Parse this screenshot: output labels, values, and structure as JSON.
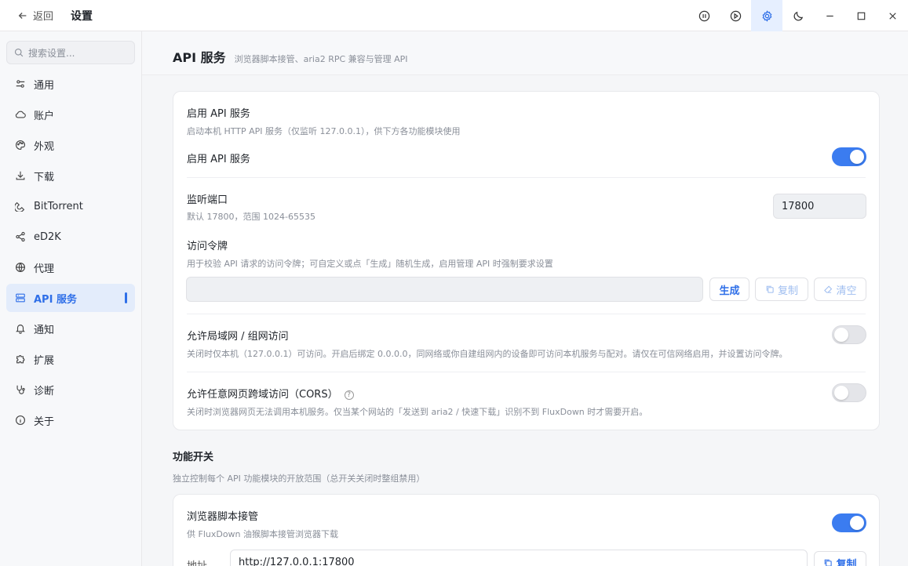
{
  "titlebar": {
    "back_label": "返回",
    "title": "设置",
    "buttons": [
      "pause-all-icon",
      "start-all-icon",
      "settings-icon",
      "theme-icon",
      "minimize-icon",
      "maximize-icon",
      "close-icon"
    ]
  },
  "sidebar": {
    "search_placeholder": "搜索设置...",
    "items": [
      {
        "label": "通用",
        "icon": "sliders-icon"
      },
      {
        "label": "账户",
        "icon": "cloud-icon"
      },
      {
        "label": "外观",
        "icon": "palette-icon"
      },
      {
        "label": "下载",
        "icon": "download-icon"
      },
      {
        "label": "BitTorrent",
        "icon": "magnet-icon"
      },
      {
        "label": "eD2K",
        "icon": "share-icon"
      },
      {
        "label": "代理",
        "icon": "globe-icon"
      },
      {
        "label": "API 服务",
        "icon": "server-icon",
        "active": true
      },
      {
        "label": "通知",
        "icon": "bell-icon"
      },
      {
        "label": "扩展",
        "icon": "puzzle-icon"
      },
      {
        "label": "诊断",
        "icon": "stethoscope-icon"
      },
      {
        "label": "关于",
        "icon": "info-icon"
      }
    ]
  },
  "main": {
    "title": "API 服务",
    "subtitle": "浏览器脚本接管、aria2 RPC 兼容与管理 API",
    "enable_section": {
      "title": "启用 API 服务",
      "desc": "启动本机 HTTP API 服务（仅监听 127.0.0.1），供下方各功能模块使用",
      "toggle_label": "启用 API 服务",
      "toggle_on": true
    },
    "port": {
      "title": "监听端口",
      "desc": "默认 17800，范围 1024-65535",
      "value": "17800"
    },
    "token": {
      "title": "访问令牌",
      "desc": "用于校验 API 请求的访问令牌；可自定义或点「生成」随机生成，启用管理 API 时强制要求设置",
      "value": "",
      "generate_label": "生成",
      "copy_label": "复制",
      "clear_label": "清空"
    },
    "lan": {
      "title": "允许局域网 / 组网访问",
      "desc": "关闭时仅本机（127.0.0.1）可访问。开启后绑定 0.0.0.0，同网络或你自建组网内的设备即可访问本机服务与配对。请仅在可信网络启用，并设置访问令牌。",
      "toggle_on": false
    },
    "cors": {
      "title": "允许任意网页跨域访问（CORS）",
      "help": "?",
      "desc": "关闭时浏览器网页无法调用本机服务。仅当某个网站的「发送到 aria2 / 快速下载」识别不到 FluxDown 时才需要开启。",
      "toggle_on": false
    },
    "features": {
      "title": "功能开关",
      "desc": "独立控制每个 API 功能模块的开放范围（总开关关闭时整组禁用）"
    },
    "browser_script": {
      "title": "浏览器脚本接管",
      "desc": "供 FluxDown 油猴脚本接管浏览器下载",
      "toggle_on": true,
      "address_label": "地址",
      "address_value": "http://127.0.0.1:17800",
      "copy_label": "复制"
    }
  },
  "colors": {
    "accent": "#2f6fe8",
    "toggle_on": "#3b7cf0"
  }
}
